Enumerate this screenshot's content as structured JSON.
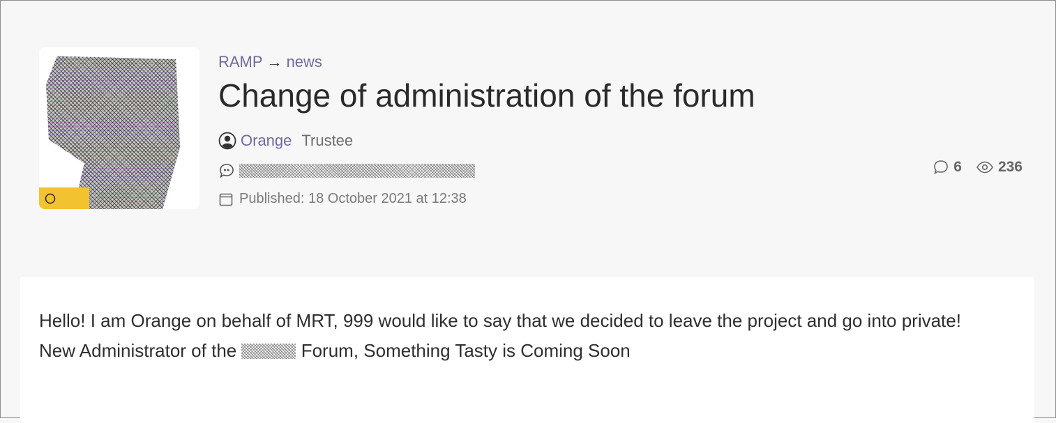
{
  "breadcrumb": {
    "root": "RAMP",
    "separator": "→",
    "section": "news"
  },
  "thread": {
    "title": "Change of administration of the forum",
    "author": {
      "name": "Orange",
      "role": "Trustee"
    },
    "published_label": "Published: 18 October 2021 at 12:38",
    "stats": {
      "replies": "6",
      "views": "236"
    }
  },
  "post": {
    "text_before": "Hello! I am Orange on behalf of MRT, 999 would like to say that we decided to leave the project and go into private! New Administrator of the",
    "text_after": "Forum, Something Tasty is Coming Soon"
  },
  "icons": {
    "author": "user-circle-icon",
    "signature": "quote-bubble-icon",
    "date": "calendar-icon",
    "replies": "comment-icon",
    "views": "eye-icon"
  },
  "colors": {
    "link": "#6f6a9e",
    "avatar_badge": "#f2c230",
    "page_background": "#f7f7f7"
  }
}
